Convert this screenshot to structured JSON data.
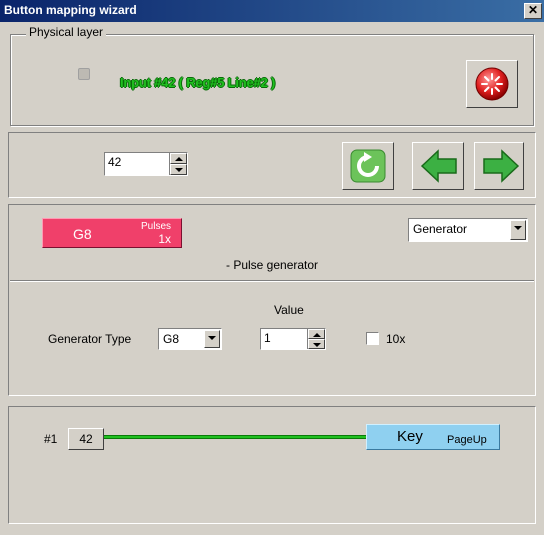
{
  "window": {
    "title": "Button mapping wizard",
    "close_glyph": "✕"
  },
  "physical_layer": {
    "legend": "Physical layer",
    "input_info": "Input #42  ( Reg#5  Line#2 )",
    "record_icon": "record-button-icon"
  },
  "navigation": {
    "number_value": "42",
    "refresh_icon": "refresh-icon",
    "back_icon": "arrow-left-icon",
    "forward_icon": "arrow-right-icon"
  },
  "action": {
    "button_main": "G8",
    "button_sub1": "Pulses",
    "button_sub2": "1x",
    "type_select": "Generator",
    "description": "- Pulse generator",
    "value_label": "Value",
    "generator_type_label": "Generator Type",
    "generator_type_value": "G8",
    "value_spin": "1",
    "tenx_label": "10x",
    "tenx_checked": false
  },
  "mapping": {
    "index_label": "#1",
    "input_number": "42",
    "key_main": "Key",
    "key_sub": "PageUp"
  },
  "colors": {
    "accent_pink": "#f0406a",
    "key_blue": "#8fd0f0",
    "line_green": "#20c020",
    "title_bar": "#0a246a"
  }
}
